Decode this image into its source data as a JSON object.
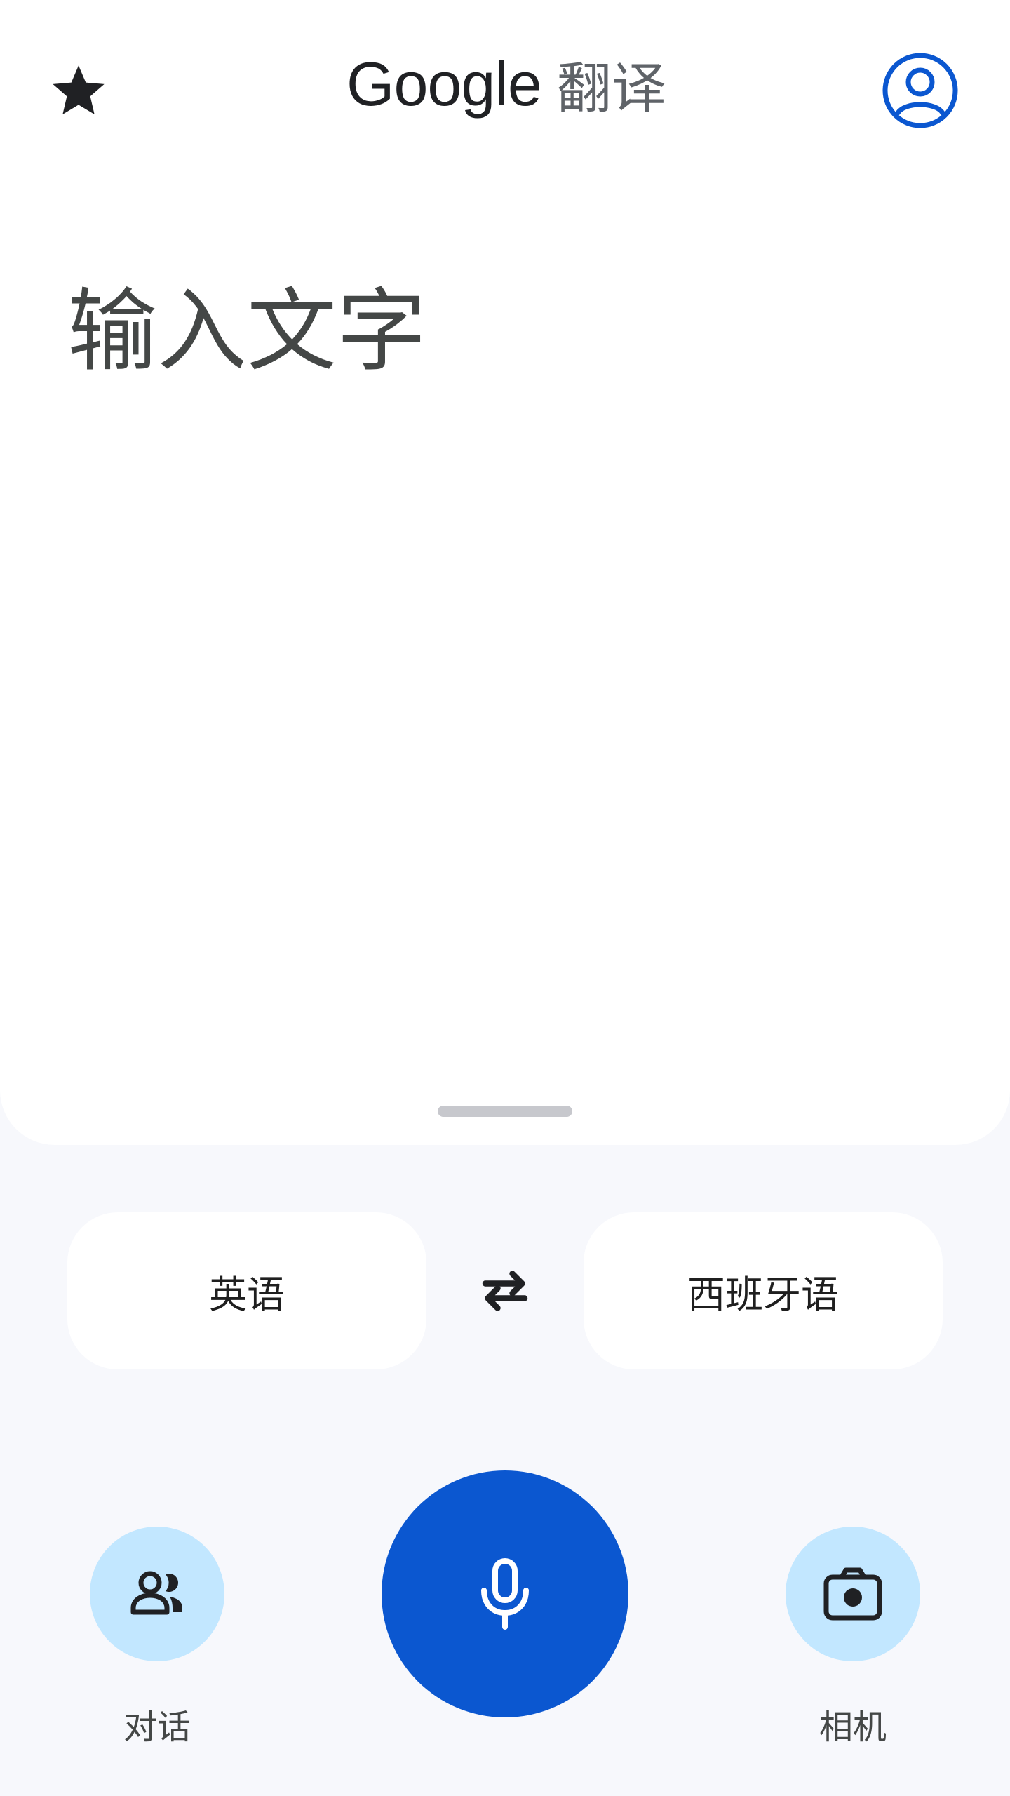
{
  "header": {
    "brand": "Google",
    "title_suffix": "翻译",
    "favorites_icon": "star-icon",
    "account_icon": "account-circle-icon"
  },
  "input": {
    "placeholder": "输入文字"
  },
  "languages": {
    "source": "英语",
    "target": "西班牙语",
    "swap_icon": "swap-arrows-icon"
  },
  "actions": {
    "conversation": {
      "label": "对话",
      "icon": "people-icon"
    },
    "voice": {
      "icon": "microphone-icon"
    },
    "camera": {
      "label": "相机",
      "icon": "camera-icon"
    }
  },
  "colors": {
    "accent": "#0b57d0",
    "action_tint": "#c2e7ff",
    "surface": "#ffffff",
    "background": "#f7f8fc"
  }
}
